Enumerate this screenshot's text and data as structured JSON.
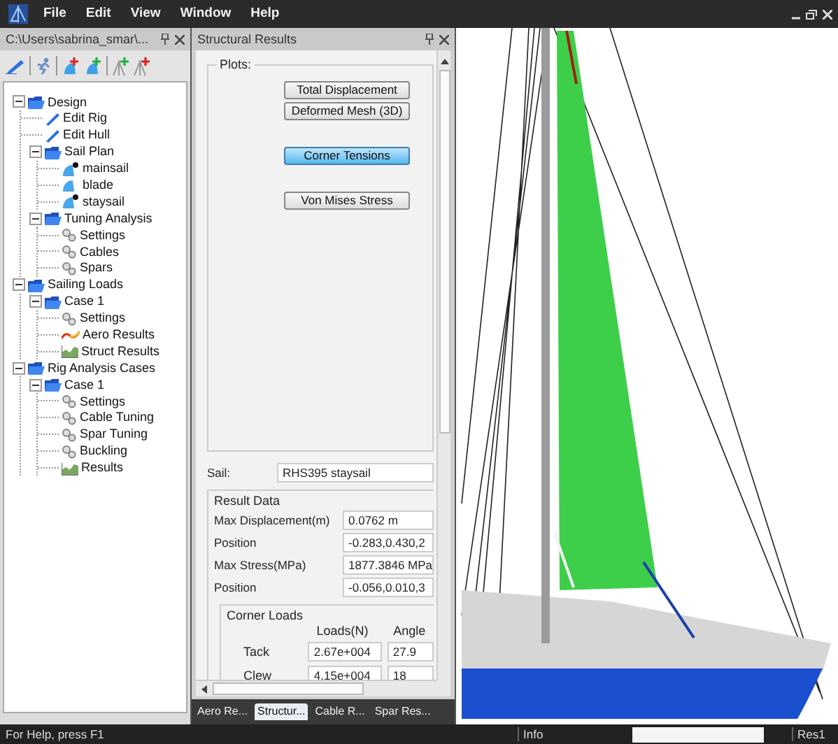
{
  "menu": [
    "File",
    "Edit",
    "View",
    "Window",
    "Help"
  ],
  "left_panel": {
    "title": "C:\\Users\\sabrina_smar\\...",
    "tree": [
      {
        "label": "Design",
        "kind": "folder",
        "expanded": true,
        "children": [
          {
            "label": "Edit Rig",
            "kind": "pencil"
          },
          {
            "label": "Edit Hull",
            "kind": "pencil"
          },
          {
            "label": "Sail Plan",
            "kind": "folder",
            "expanded": true,
            "children": [
              {
                "label": "mainsail",
                "kind": "sail",
                "visible": true
              },
              {
                "label": "blade",
                "kind": "sail",
                "visible": false
              },
              {
                "label": "staysail",
                "kind": "sail",
                "visible": true
              }
            ]
          },
          {
            "label": "Tuning Analysis",
            "kind": "folder",
            "expanded": true,
            "children": [
              {
                "label": "Settings",
                "kind": "gears"
              },
              {
                "label": "Cables",
                "kind": "gears"
              },
              {
                "label": "Spars",
                "kind": "gears"
              }
            ]
          }
        ]
      },
      {
        "label": "Sailing Loads",
        "kind": "folder",
        "expanded": true,
        "children": [
          {
            "label": "Case 1",
            "kind": "folder",
            "expanded": true,
            "children": [
              {
                "label": "Settings",
                "kind": "gears"
              },
              {
                "label": "Aero Results",
                "kind": "aero"
              },
              {
                "label": "Struct Results",
                "kind": "chart"
              }
            ]
          }
        ]
      },
      {
        "label": "Rig Analysis Cases",
        "kind": "folder",
        "expanded": true,
        "children": [
          {
            "label": "Case 1",
            "kind": "folder",
            "expanded": true,
            "children": [
              {
                "label": "Settings",
                "kind": "gears"
              },
              {
                "label": "Cable Tuning",
                "kind": "gears"
              },
              {
                "label": "Spar Tuning",
                "kind": "gears"
              },
              {
                "label": "Buckling",
                "kind": "gears"
              },
              {
                "label": "Results",
                "kind": "chart"
              }
            ]
          }
        ]
      }
    ]
  },
  "structural_panel": {
    "title": "Structural Results",
    "plots_label": "Plots:",
    "plot_buttons": [
      {
        "label": "Total Displacement",
        "selected": false
      },
      {
        "label": "Deformed Mesh (3D)",
        "selected": false
      },
      {
        "label": "Corner Tensions",
        "selected": true
      },
      {
        "label": "Von Mises Stress",
        "selected": false
      }
    ],
    "sail_label": "Sail:",
    "sail_value": "RHS395 staysail",
    "result_data": {
      "title": "Result Data",
      "rows": [
        {
          "label": "Max Displacement(m)",
          "value": "0.0762 m"
        },
        {
          "label": "Position",
          "value": "-0.283,0.430,2"
        },
        {
          "label": "Max Stress(MPa)",
          "value": "1877.3846 MPa"
        },
        {
          "label": "Position",
          "value": "-0.056,0.010,3"
        }
      ]
    },
    "corner_loads": {
      "title": "Corner Loads",
      "columns": [
        "Loads(N)",
        "Angle"
      ],
      "rows": [
        {
          "label": "Tack",
          "loads": "2.67e+004",
          "angle": "27.9"
        },
        {
          "label": "Clew",
          "loads": "4.15e+004",
          "angle": "18"
        }
      ]
    }
  },
  "bottom_tabs": [
    {
      "label": "Aero Re...",
      "selected": false
    },
    {
      "label": "Structur...",
      "selected": true
    },
    {
      "label": "Cable R...",
      "selected": false
    },
    {
      "label": "Spar Res...",
      "selected": false
    }
  ],
  "status_bar": {
    "help": "For Help, press F1",
    "info": "Info",
    "result": "Res1"
  }
}
